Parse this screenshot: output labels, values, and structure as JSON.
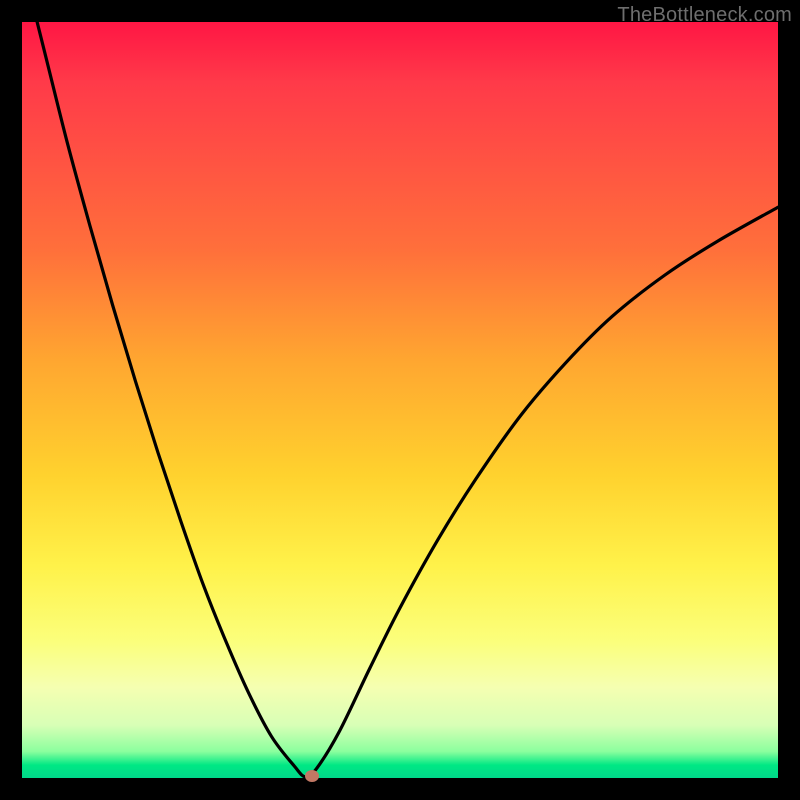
{
  "watermark": "TheBottleneck.com",
  "colors": {
    "frame": "#000000",
    "curve_stroke": "#000000",
    "marker": "#c17864"
  },
  "chart_data": {
    "type": "line",
    "title": "",
    "xlabel": "",
    "ylabel": "",
    "xlim": [
      0,
      100
    ],
    "ylim": [
      0,
      100
    ],
    "grid": false,
    "series": [
      {
        "name": "bottleneck-curve",
        "x": [
          0,
          3,
          6,
          9,
          12,
          15,
          18,
          21,
          24,
          27,
          30,
          33,
          36,
          37.5,
          39,
          42,
          46,
          50,
          55,
          60,
          66,
          72,
          78,
          85,
          92,
          100
        ],
        "y": [
          108,
          96,
          84,
          73,
          62.5,
          52.5,
          43,
          34,
          25.5,
          18,
          11.2,
          5.5,
          1.6,
          0.15,
          1.3,
          6.2,
          14.5,
          22.5,
          31.5,
          39.5,
          48,
          55,
          61,
          66.5,
          71,
          75.5
        ]
      }
    ],
    "marker": {
      "x": 38.3,
      "y": 0.3
    },
    "gradient_stops": [
      {
        "pos": 0,
        "color": "#ff1644"
      },
      {
        "pos": 30,
        "color": "#ff6f3b"
      },
      {
        "pos": 60,
        "color": "#ffd22e"
      },
      {
        "pos": 82,
        "color": "#fbff7c"
      },
      {
        "pos": 96.5,
        "color": "#8bff9e"
      },
      {
        "pos": 100,
        "color": "#00d88a"
      }
    ]
  }
}
